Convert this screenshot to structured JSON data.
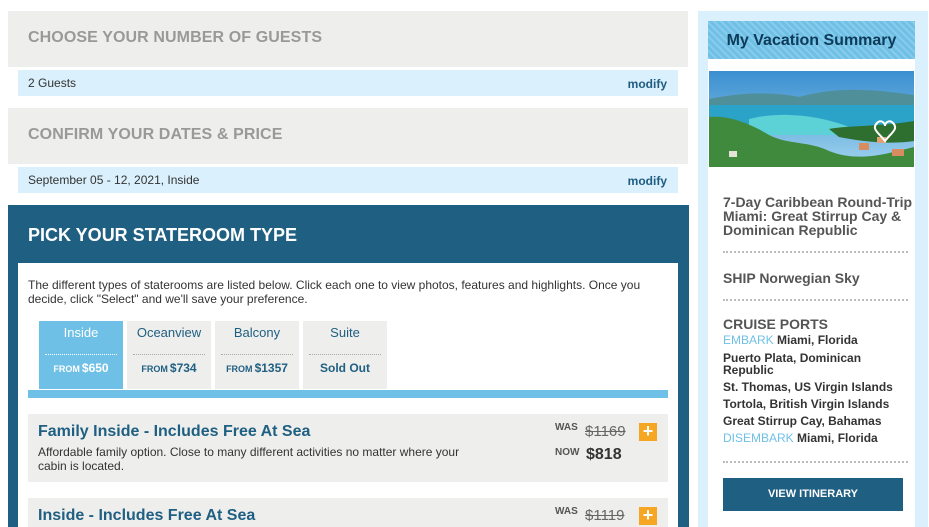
{
  "guests": {
    "heading": "CHOOSE YOUR NUMBER OF GUESTS",
    "value": "2 Guests",
    "modify": "modify"
  },
  "dates": {
    "heading": "CONFIRM YOUR DATES & PRICE",
    "value": "September 05 - 12, 2021, Inside",
    "modify": "modify"
  },
  "stateroom": {
    "heading": "PICK YOUR STATEROOM TYPE",
    "intro": "The different types of staterooms are listed below. Click each one to view photos, features and highlights. Once you decide, click \"Select\" and we'll save your preference.",
    "tabs": [
      {
        "name": "Inside",
        "from": "FROM",
        "price": "$650",
        "active": true
      },
      {
        "name": "Oceanview",
        "from": "FROM",
        "price": "$734"
      },
      {
        "name": "Balcony",
        "from": "FROM",
        "price": "$1357"
      },
      {
        "name": "Suite",
        "from": "",
        "price": "Sold Out"
      }
    ],
    "rooms": [
      {
        "title": "Family Inside - Includes Free At Sea",
        "desc": "Affordable family option. Close to many different activities no matter where your cabin is located.",
        "was_label": "WAS",
        "was": "$1169",
        "now_label": "NOW",
        "now": "$818"
      },
      {
        "title": "Inside - Includes Free At Sea",
        "desc": "",
        "was_label": "WAS",
        "was": "$1119",
        "now_label": "",
        "now": ""
      }
    ],
    "plus": "+"
  },
  "summary": {
    "title": "My Vacation Summary",
    "cruise_title": "7-Day Caribbean Round-Trip Miami: Great Stirrup Cay & Dominican Republic",
    "ship": "SHIP Norwegian Sky",
    "ports_heading": "CRUISE PORTS",
    "ports": [
      {
        "tag": "EMBARK",
        "name": " Miami, Florida"
      },
      {
        "tag": "",
        "name": "Puerto Plata, Dominican Republic"
      },
      {
        "tag": "",
        "name": "St. Thomas, US Virgin Islands"
      },
      {
        "tag": "",
        "name": "Tortola, British Virgin Islands"
      },
      {
        "tag": "",
        "name": "Great Stirrup Cay, Bahamas"
      },
      {
        "tag": "DISEMBARK",
        "name": " Miami, Florida"
      }
    ],
    "button": "VIEW ITINERARY"
  },
  "colors": {
    "accent": "#1f5f82",
    "light_blue": "#6fc0e6",
    "pale_blue": "#daf0fc",
    "orange": "#f5a623",
    "gray_bg": "#eeeeec"
  }
}
